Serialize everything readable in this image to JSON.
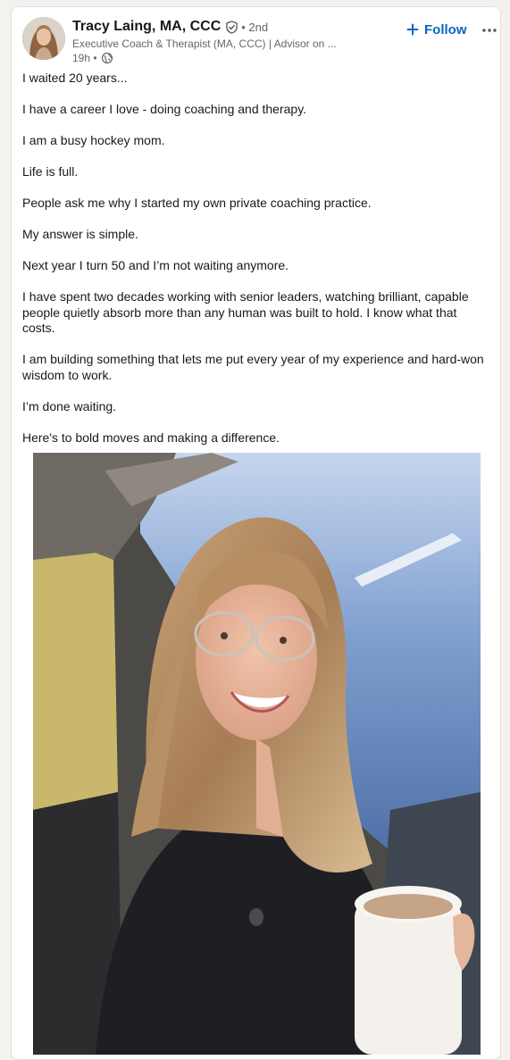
{
  "post": {
    "author": {
      "name": "Tracy Laing, MA, CCC",
      "degree": "• 2nd",
      "headline": "Executive Coach & Therapist (MA, CCC) | Advisor on ...",
      "time": "19h •"
    },
    "actions": {
      "follow_label": "Follow"
    },
    "paragraphs": [
      "I waited 20 years...",
      "I have a career I love - doing coaching and therapy.",
      "I am a busy hockey mom.",
      "Life is full.",
      "People ask me why I started my own private coaching practice.",
      "My answer is simple.",
      "Next year I turn 50 and I’m not waiting anymore.",
      "I have spent two decades working with senior leaders, watching brilliant, capable people quietly absorb more than any human was built to hold. I know what that costs.",
      "I am building something that lets me put every year of my experience and hard-won wisdom to work.",
      "I’m done waiting.",
      "Here's to bold moves and making a difference."
    ]
  },
  "icons": {
    "verified": "verified-shield-icon",
    "visibility": "globe-icon",
    "follow": "plus-icon",
    "more": "more-horizontal-icon"
  },
  "colors": {
    "accent": "#0a66c2",
    "secondary_text": "#666666",
    "primary_text": "#191919",
    "page_background": "#f4f2ee",
    "card_background": "#ffffff"
  }
}
